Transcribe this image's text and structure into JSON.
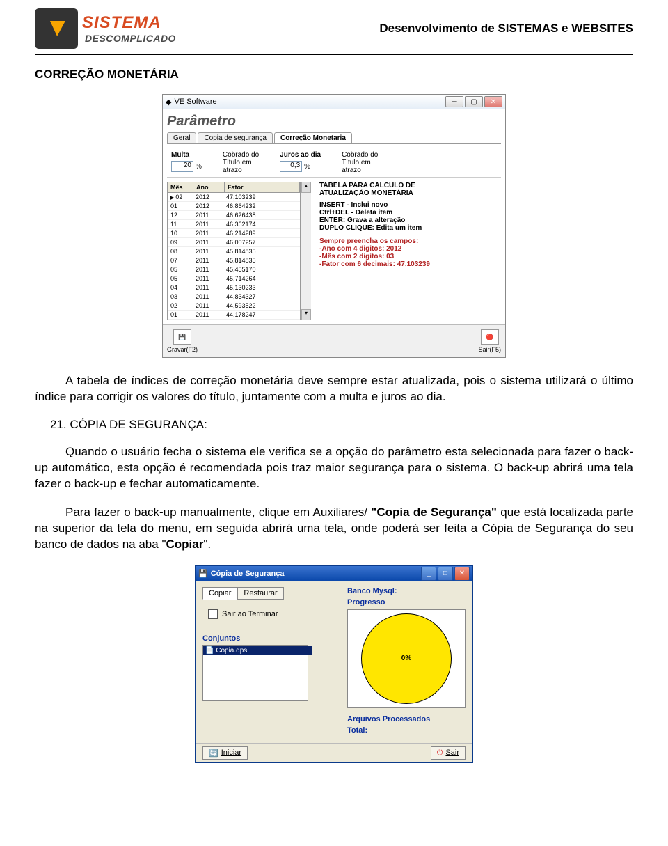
{
  "header": {
    "logo_line1": "SISTEMA",
    "logo_line2": "DESCOMPLICADO",
    "tagline": "Desenvolvimento de SISTEMAS e WEBSITES"
  },
  "page": {
    "h1": "CORREÇÃO MONETÁRIA",
    "para1": "A tabela de índices de correção monetária deve sempre estar atualizada, pois o sistema utilizará o último índice para corrigir os valores do título, juntamente com a multa e juros ao dia.",
    "heading2": "21. CÓPIA DE SEGURANÇA:",
    "para2": "Quando o usuário fecha o sistema ele verifica se a opção do parâmetro esta selecionada para fazer o back-up automático, esta opção é recomendada pois traz maior segurança para o sistema. O back-up abrirá uma tela fazer o back-up e fechar automaticamente.",
    "para3_a": "Para fazer o back-up manualmente, clique  em Auxiliares/ ",
    "para3_b": "Copia de Segurança",
    "para3_c": " que está localizada parte na superior da tela do menu, em seguida abrirá uma tela, onde poderá ser feita a Cópia de Segurança do seu ",
    "para3_d": "banco de dados",
    "para3_e": " na aba ",
    "para3_f": "Copiar",
    "para3_g": "."
  },
  "win": {
    "title": "VE Software",
    "heading": "Parâmetro",
    "tabs": [
      "Geral",
      "Copia de segurança",
      "Correção Monetaria"
    ],
    "multa_label": "Multa",
    "multa_val": "20",
    "multa_suffix": "%",
    "multa_desc": "Cobrado do\nTítulo em\natrazo",
    "juros_label": "Juros ao dia",
    "juros_val": "0,3",
    "juros_suffix": "%",
    "juros_desc": "Cobrado do\nTítulo em\natrazo",
    "cols": [
      "Mês",
      "Ano",
      "Fator"
    ],
    "rows": [
      [
        "02",
        "2012",
        "47,103239"
      ],
      [
        "01",
        "2012",
        "46,864232"
      ],
      [
        "12",
        "2011",
        "46,626438"
      ],
      [
        "11",
        "2011",
        "46,362174"
      ],
      [
        "10",
        "2011",
        "46,214289"
      ],
      [
        "09",
        "2011",
        "46,007257"
      ],
      [
        "08",
        "2011",
        "45,814835"
      ],
      [
        "07",
        "2011",
        "45,814835"
      ],
      [
        "05",
        "2011",
        "45,455170"
      ],
      [
        "05",
        "2011",
        "45,714264"
      ],
      [
        "04",
        "2011",
        "45,130233"
      ],
      [
        "03",
        "2011",
        "44,834327"
      ],
      [
        "02",
        "2011",
        "44,593522"
      ],
      [
        "01",
        "2011",
        "44,178247"
      ]
    ],
    "info": {
      "title": "TABELA PARA CALCULO DE\nATUALIZAÇÃO MONETÁRIA",
      "lines": [
        "INSERT - Inclui novo",
        "Ctrl+DEL - Deleta item",
        "ENTER: Grava a alteração",
        "DUPLO CLIQUE: Edita um item"
      ],
      "warn_head": "Sempre preencha os campos:",
      "warn": [
        "-Ano com 4 digitos: 2012",
        "-Mês com 2 digitos: 03",
        "-Fator com 6  decimais: 47,103239"
      ]
    },
    "footer": {
      "save": "Gravar(F2)",
      "exit": "Sair(F5)"
    }
  },
  "win2": {
    "title": "Cópia de Segurança",
    "tabs": [
      "Copiar",
      "Restaurar"
    ],
    "sair": "Sair ao Terminar",
    "conjuntos": "Conjuntos",
    "item": "Copia.dps",
    "banco": "Banco Mysql:",
    "progresso": "Progresso",
    "pct": "0%",
    "arquivos": "Arquivos Processados",
    "total": "Total:",
    "iniciar": "Iniciar",
    "sair_btn": "Sair"
  }
}
